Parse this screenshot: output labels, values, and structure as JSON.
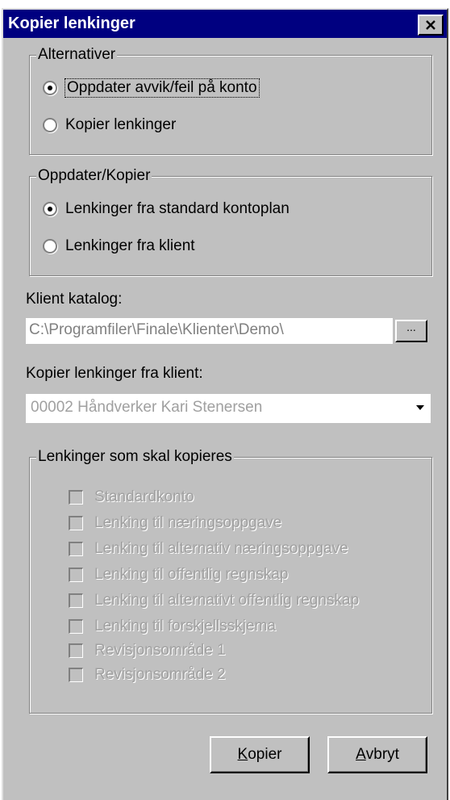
{
  "window": {
    "title": "Kopier lenkinger",
    "close_icon": "close-icon"
  },
  "alternatives": {
    "legend": "Alternativer",
    "options": [
      {
        "label": "Oppdater avvik/feil på konto",
        "checked": true
      },
      {
        "label": "Kopier lenkinger",
        "checked": false
      }
    ]
  },
  "update_copy": {
    "legend": "Oppdater/Kopier",
    "options": [
      {
        "label": "Lenkinger fra standard kontoplan",
        "checked": true
      },
      {
        "label": "Lenkinger fra klient",
        "checked": false
      }
    ]
  },
  "client_directory": {
    "label": "Klient katalog:",
    "value": "C:\\Programfiler\\Finale\\Klienter\\Demo\\",
    "browse_label": "..."
  },
  "copy_from_client": {
    "label": "Kopier lenkinger fra klient:",
    "selected": "00002  Håndverker Kari Stenersen"
  },
  "links_to_copy": {
    "legend": "Lenkinger som skal kopieres",
    "items": [
      "Standardkonto",
      "Lenking til næringsoppgave",
      "Lenking til alternativ næringsoppgave",
      "Lenking til offentlig regnskap",
      "Lenking til alternativt offentlig regnskap",
      "Lenking til forskjellsskjema",
      "Revisjonsområde 1",
      "Revisjonsområde 2"
    ]
  },
  "buttons": {
    "copy_mnemonic": "K",
    "copy_rest": "opier",
    "cancel_mnemonic": "A",
    "cancel_rest": "vbryt"
  }
}
